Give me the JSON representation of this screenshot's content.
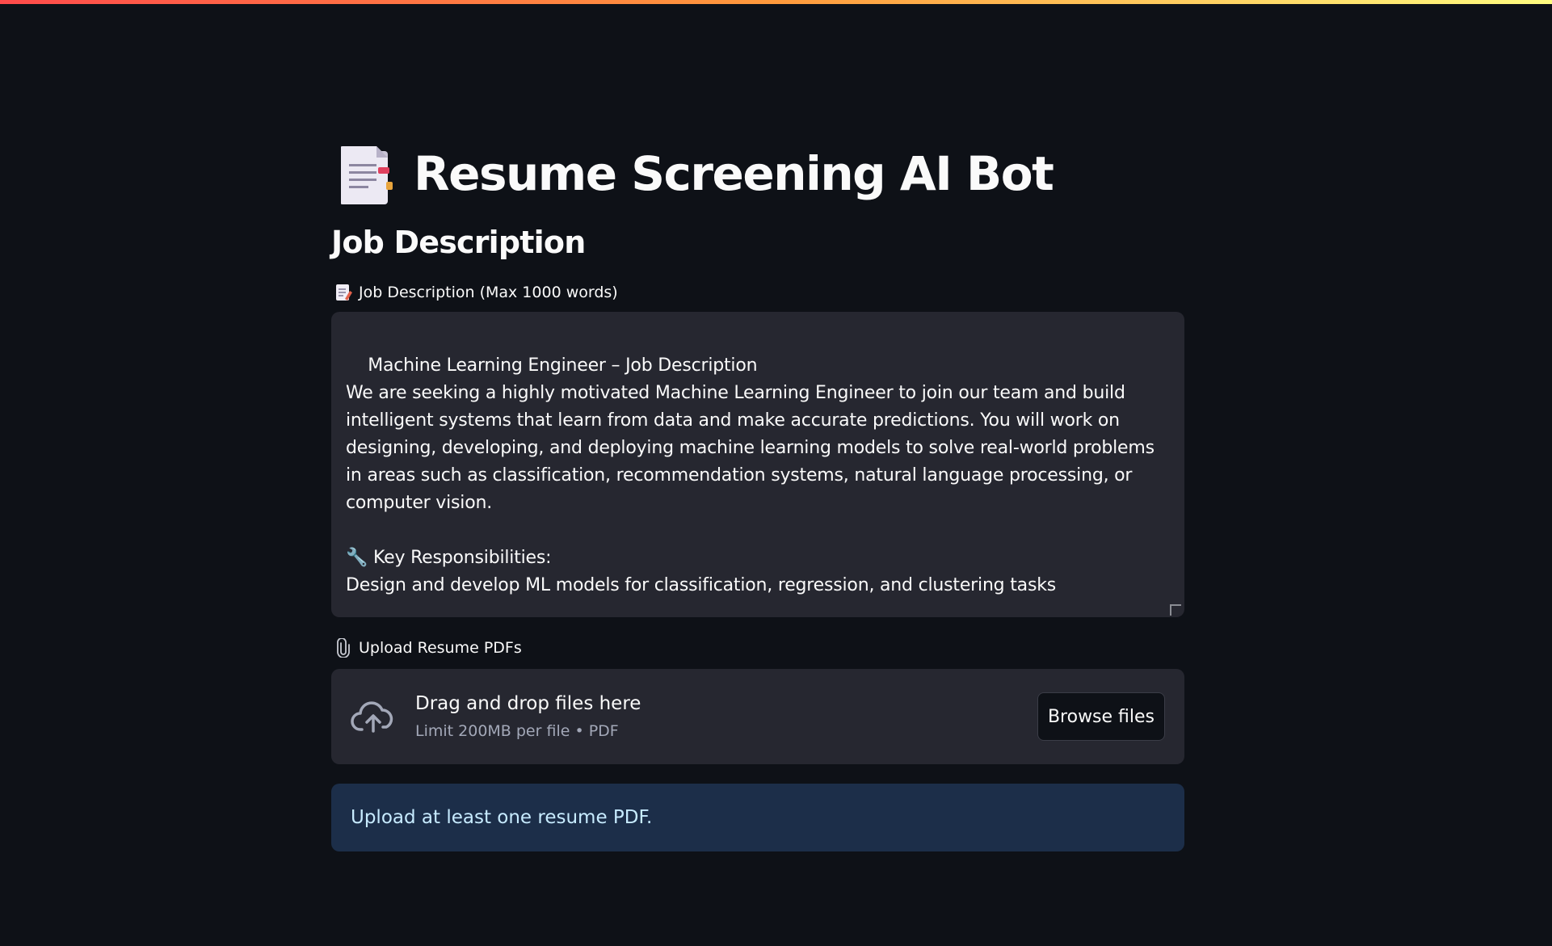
{
  "app": {
    "title": "Resume Screening AI Bot",
    "title_icon": "page-facing-up-icon"
  },
  "job_section": {
    "heading": "Job Description",
    "label": "Job Description (Max 1000 words)",
    "label_icon": "memo-icon",
    "value": "Machine Learning Engineer – Job Description\nWe are seeking a highly motivated Machine Learning Engineer to join our team and build intelligent systems that learn from data and make accurate predictions. You will work on designing, developing, and deploying machine learning models to solve real-world problems in areas such as classification, recommendation systems, natural language processing, or computer vision.\n\n🔧 Key Responsibilities:\nDesign and develop ML models for classification, regression, and clustering tasks\n\nPreprocess large datasets using data wrangling, cleaning, and transformation techniques"
  },
  "upload_section": {
    "label": "Upload Resume PDFs",
    "label_icon": "paperclip-icon",
    "drop_text": "Drag and drop files here",
    "limit_text": "Limit 200MB per file • PDF",
    "browse_label": "Browse files",
    "upload_icon": "cloud-upload-icon"
  },
  "info": {
    "message": "Upload at least one resume PDF."
  },
  "colors": {
    "background": "#0e1117",
    "input_bg": "#262730",
    "info_bg": "#1c2e49",
    "info_text": "#c7ebff"
  }
}
